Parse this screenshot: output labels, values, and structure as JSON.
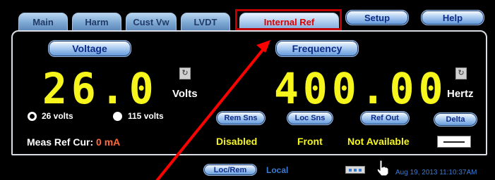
{
  "tabs": [
    {
      "label": "Main"
    },
    {
      "label": "Harm"
    },
    {
      "label": "Cust Vw"
    },
    {
      "label": "LVDT"
    },
    {
      "label": "Internal Ref"
    }
  ],
  "top_buttons": {
    "setup": "Setup",
    "help": "Help"
  },
  "voltage": {
    "header": "Voltage",
    "value": "26.0",
    "unit": "Volts",
    "radio_26": "26 volts",
    "radio_115": "115 volts",
    "selected": "26 volts"
  },
  "frequency": {
    "header": "Frequency",
    "value": "400.00",
    "unit": "Hertz"
  },
  "controls": {
    "rem_sns": "Rem Sns",
    "loc_sns": "Loc Sns",
    "ref_out": "Ref Out",
    "delta": "Delta"
  },
  "statuses": {
    "rem_sns": "Disabled",
    "loc_sns": "Front",
    "ref_out": "Not Available"
  },
  "meas": {
    "label": "Meas Ref Cur:",
    "value": "0 mA"
  },
  "bottom": {
    "loc_rem_button": "Loc/Rem",
    "mode": "Local",
    "timestamp": "Aug 19, 2013  11:10:37AM"
  },
  "colors": {
    "accent_red": "#e00000",
    "digits_yellow": "#f6f61c",
    "status_blue": "#3a7bd5"
  }
}
